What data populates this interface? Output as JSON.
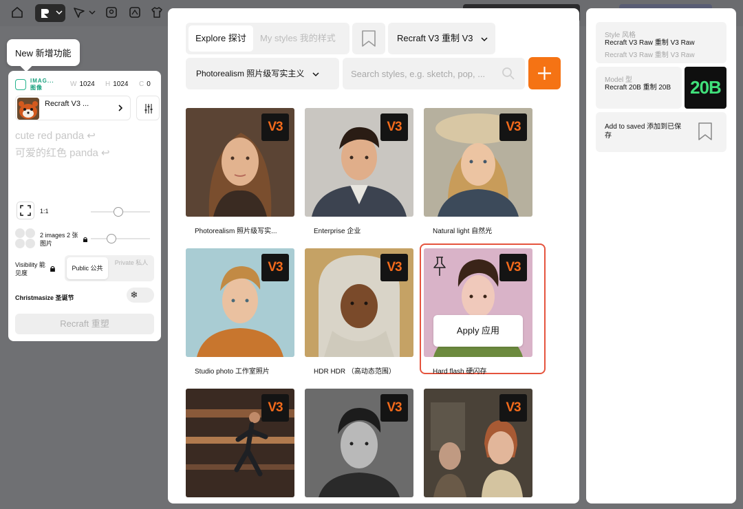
{
  "tooltip": {
    "new_feature": "New 新增功能"
  },
  "left_panel": {
    "image_type": "IMAG... 图像",
    "width_label": "W",
    "width_value": "1024",
    "height_label": "H",
    "height_value": "1024",
    "seed_label": "C",
    "seed_value": "0",
    "model_name": "Recraft V3 ...",
    "prompt_line1": "cute red panda ↩",
    "prompt_line2": "可爱的红色 panda ↩",
    "ratio_label": "1:1",
    "images_label": "2 images 2 张图片",
    "visibility_label": "Visibility 能见度",
    "public_label": "Public 公共",
    "private_label": "Private 私人",
    "christmas_label": "Christmasize 圣诞节",
    "generate_label": "Recraft   重塑"
  },
  "modal": {
    "tab_explore": "Explore 探讨",
    "tab_my_styles": "My styles 我的样式",
    "version_label": "Recraft V3   重制 V3",
    "style_dropdown": "Photorealism   照片级写实主义",
    "search_placeholder": "Search styles, e.g. sketch, pop, ...",
    "badge_text": "V3",
    "apply_label": "Apply   应用",
    "styles": [
      {
        "label": "Photorealism 照片级写实..."
      },
      {
        "label": "Enterprise 企业"
      },
      {
        "label": "Natural light 自然光"
      },
      {
        "label": "Studio photo 工作室照片"
      },
      {
        "label": "HDR HDR （高动态范围）"
      },
      {
        "label": "Hard flash 硬闪存"
      },
      {
        "label": ""
      },
      {
        "label": ""
      },
      {
        "label": ""
      }
    ]
  },
  "right_panel": {
    "style_key": "Style 风格",
    "style_value": "Recraft V3 Raw 重制 V3 Raw",
    "style_sub": "Recraft V3 Raw 重制 V3 Raw",
    "model_key": "Model 型",
    "model_value": "Recraft 20B 重制 20B",
    "model_logo": "20B",
    "save_label": "Add to saved 添加到已保存"
  },
  "colors": {
    "accent": "#f57314",
    "selected_border": "#e5533d",
    "badge_text": "#f26a1b",
    "model_logo": "#40e07a"
  }
}
